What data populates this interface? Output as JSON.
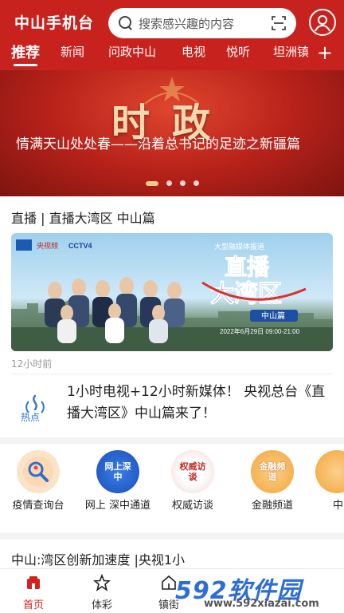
{
  "header": {
    "app_title": "中山手机台",
    "search_placeholder": "搜索感兴趣的内容"
  },
  "tabs": [
    "推荐",
    "新闻",
    "问政中山",
    "电视",
    "悦听",
    "坦洲镇"
  ],
  "banner": {
    "big_text": "时政",
    "headline": "情满天山处处春——沿着总书记的足迹之新疆篇",
    "slide_count": 4,
    "active_slide": 1
  },
  "live": {
    "section_title": "直播 | 直播大湾区 中山篇",
    "time_ago": "12小时前",
    "poster": {
      "logo_left": "央视频",
      "logo_cctv": "CCTV4",
      "report_tag": "大型融媒体报道",
      "title_line1": "直播",
      "title_line2": "大湾区",
      "subtitle": "中山篇",
      "date_text": "2022年6月29日 09:00-21:00"
    }
  },
  "hot_news": {
    "badge_label": "热点",
    "text": "1小时电视+12小时新媒体！ 央视总台《直播大湾区》中山篇来了！"
  },
  "quick_entries": [
    {
      "label": "疫情查询台",
      "icon_text": ""
    },
    {
      "label": "网上 深中通道",
      "icon_text": "网上深中"
    },
    {
      "label": "权威访谈",
      "icon_text": "权威访谈"
    },
    {
      "label": "金融频道",
      "icon_text": "金融频道"
    },
    {
      "label": "中",
      "icon_text": ""
    }
  ],
  "bottom_headline": "中山:湾区创新加速度 |央视1小",
  "bottom_nav": [
    {
      "label": "首页",
      "icon": "home-icon"
    },
    {
      "label": "体彩",
      "icon": "star-icon"
    },
    {
      "label": "镇街",
      "icon": "building-icon"
    }
  ],
  "watermark": {
    "big": "592软件园",
    "small": "www.592xiazai.com"
  },
  "colors": {
    "brand_red": "#c8221e",
    "accent_gold": "#f0c98a"
  }
}
